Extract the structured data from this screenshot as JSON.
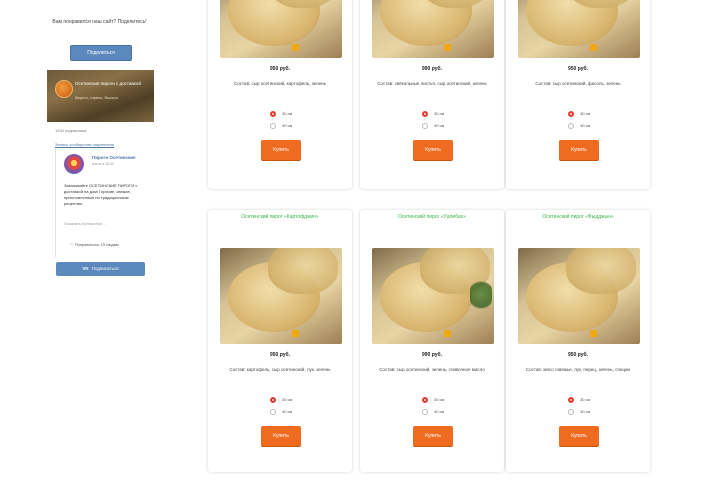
{
  "share": {
    "title": "Вам понравился наш сайт? Поделитесь!",
    "button": "Поделиться"
  },
  "vk": {
    "cover_name": "Осетинские пироги с доставкой",
    "cover_sub": "Вкусно, горячо, быстро",
    "subscribers": "1234 подписчика",
    "post_link": "Запись сообщества закреплена",
    "author": "Пироги Осетинские",
    "date": "вчера в 18:30",
    "text": "Заказывайте ОСЕТИНСКИЕ ПИРОГИ с доставкой на дом! Горячие, свежие, приготовленные по традиционным рецептам.",
    "more": "Показать полностью…",
    "likes": "♡ Понравилось 15 людям",
    "subscribe": "Подписаться"
  },
  "colors": {
    "accent_orange": "#ef6b1f",
    "title_green": "#3eb54a",
    "vk_blue": "#5b88bd",
    "radio_red": "#e53b2e"
  },
  "products": [
    {
      "title": "",
      "price": "950 руб.",
      "desc": "Состав: сыр осетинский, картофель, зелень",
      "option_a": "30 см",
      "option_b": "40 см",
      "buy": "Купить"
    },
    {
      "title": "",
      "price": "990 руб.",
      "desc": "Состав: свёкольные листья, сыр осетинский, зелень",
      "option_a": "30 см",
      "option_b": "40 см",
      "buy": "Купить"
    },
    {
      "title": "",
      "price": "950 руб.",
      "desc": "Состав: сыр осетинский, фасоль, зелень",
      "option_a": "30 см",
      "option_b": "40 см",
      "buy": "Купить"
    },
    {
      "title": "Осетинский пирог «Картофджин»",
      "price": "950 руб.",
      "desc": "Состав: картофель, сыр осетинский, лук, зелень",
      "option_a": "30 см",
      "option_b": "40 см",
      "buy": "Купить"
    },
    {
      "title": "Осетинский пирог «Уалибах»",
      "price": "990 руб.",
      "desc": "Состав: сыр осетинский, зелень, сливочное масло",
      "option_a": "30 см",
      "option_b": "40 см",
      "buy": "Купить"
    },
    {
      "title": "Осетинский пирог «Фыдджын»",
      "price": "950 руб.",
      "desc": "Состав: мясо говяжье, лук, перец, зелень, специи",
      "option_a": "30 см",
      "option_b": "40 см",
      "buy": "Купить"
    }
  ]
}
